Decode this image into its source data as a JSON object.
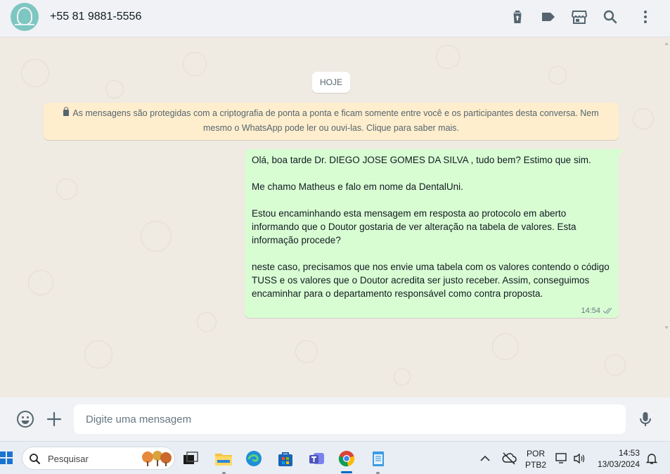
{
  "header": {
    "contact_name": "+55 81 9881-5556",
    "icons": [
      "trash-icon",
      "label-icon",
      "store-icon",
      "search-icon",
      "menu-icon"
    ]
  },
  "chat": {
    "day_label": "HOJE",
    "encryption_notice": "As mensagens são protegidas com a criptografia de ponta a ponta e ficam somente entre você e os participantes desta conversa. Nem mesmo o WhatsApp pode ler ou ouvi-las. Clique para saber mais.",
    "message": {
      "paragraphs": [
        "Olá, boa tarde Dr. DIEGO JOSE GOMES DA SILVA , tudo bem? Estimo que sim.",
        "Me chamo Matheus e falo em nome da DentalUni.",
        "Estou encaminhando esta mensagem em resposta ao protocolo em aberto informando que o Doutor gostaria de ver alteração na tabela de valores. Esta informação procede?",
        "neste caso, precisamos que nos envie uma tabela com os valores contendo o código TUSS e os valores que o Doutor acredita ser justo receber. Assim, conseguimos encaminhar para o departamento responsável como contra proposta."
      ],
      "time": "14:54",
      "status": "delivered"
    }
  },
  "composer": {
    "placeholder": "Digite uma mensagem"
  },
  "taskbar": {
    "search_placeholder": "Pesquisar",
    "language": "POR",
    "layout": "PTB2",
    "time": "14:53",
    "date": "13/03/2024"
  },
  "colors": {
    "outgoing_bubble": "#d9fdd3",
    "notice_bg": "#ffeecd",
    "chat_bg": "#efeae2",
    "header_bg": "#f0f2f5"
  }
}
